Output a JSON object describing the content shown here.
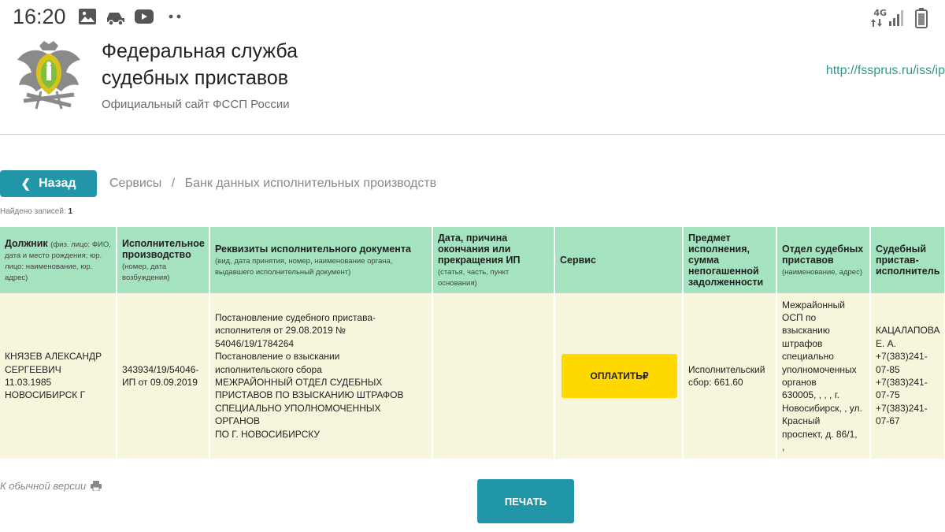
{
  "status_bar": {
    "time": "16:20",
    "network": "4G"
  },
  "header": {
    "title_line1": "Федеральная служба",
    "title_line2": "судебных приставов",
    "subtitle": "Официальный сайт ФССП России",
    "url": "http://fssprus.ru/iss/ip"
  },
  "nav": {
    "back_label": "Назад",
    "breadcrumb": [
      "Сервисы",
      "Банк данных исполнительных производств"
    ],
    "separator": "/"
  },
  "results": {
    "found_label": "Найдено записей:",
    "found_count": "1"
  },
  "table": {
    "headers": [
      {
        "title": "Должник",
        "hint": "(физ. лицо: ФИО, дата и место рождения; юр. лицо: наименование, юр. адрес)"
      },
      {
        "title": "Исполнительное производство",
        "hint": "(номер, дата возбуждения)"
      },
      {
        "title": "Реквизиты исполнительного документа",
        "hint": "(вид, дата принятия, номер, наименование органа, выдавшего исполнительный документ)"
      },
      {
        "title": "Дата, причина окончания или прекращения ИП",
        "hint": "(статья, часть, пункт основания)"
      },
      {
        "title": "Сервис",
        "hint": ""
      },
      {
        "title": "Предмет исполнения, сумма непогашенной задолженности",
        "hint": ""
      },
      {
        "title": "Отдел судебных приставов",
        "hint": "(наименование, адрес)"
      },
      {
        "title": "Судебный пристав-исполнитель",
        "hint": ""
      }
    ],
    "row": {
      "debtor": [
        "КНЯЗЕВ АЛЕКСАНДР",
        "СЕРГЕЕВИЧ",
        "11.03.1985",
        "НОВОСИБИРСК Г"
      ],
      "proceeding": [
        "343934/19/54046-",
        "ИП от 09.09.2019"
      ],
      "document": [
        "Постановление судебного пристава-",
        "исполнителя от 29.08.2019 №",
        "54046/19/1784264",
        "Постановление о взыскании",
        "исполнительского сбора",
        "МЕЖРАЙОННЫЙ ОТДЕЛ СУДЕБНЫХ",
        "ПРИСТАВОВ ПО ВЗЫСКАНИЮ ШТРАФОВ",
        "СПЕЦИАЛЬНО УПОЛНОМОЧЕННЫХ ОРГАНОВ",
        "ПО Г. НОВОСИБИРСКУ"
      ],
      "end_date": "",
      "pay_label": "ОПЛАТИТЬ",
      "pay_currency": "₽",
      "subject": [
        "Исполнительский",
        "сбор: 661.60"
      ],
      "department": [
        "Межрайонный",
        "ОСП по",
        "взысканию",
        "штрафов",
        "специально",
        "уполномоченных",
        "органов",
        "630005, , , , г.",
        "Новосибирск, , ул.",
        "Красный",
        "проспект, д. 86/1,",
        ","
      ],
      "bailiff": [
        "КАЦАЛАПОВА",
        "Е. А.",
        "+7(383)241-",
        "07-85",
        "+7(383)241-",
        "07-75",
        "+7(383)241-",
        "07-67"
      ]
    }
  },
  "footer": {
    "regular_version": "К обычной версии",
    "print_label": "ПЕЧАТЬ"
  },
  "colors": {
    "accent": "#2196a8",
    "header_row": "#a5e2bf",
    "data_row": "#f7f6dc",
    "pay": "#ffd800",
    "url": "#2e9b8e"
  }
}
